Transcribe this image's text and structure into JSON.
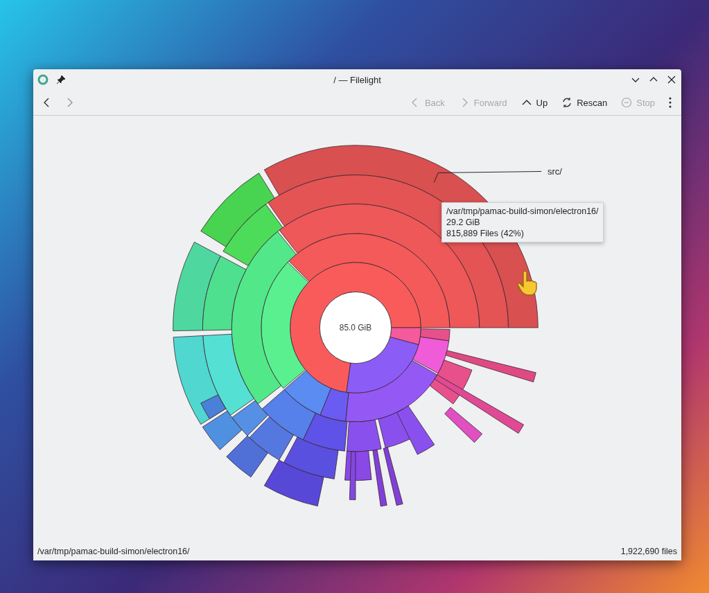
{
  "window": {
    "title": "/ — Filelight"
  },
  "nav": [
    {
      "kind": "back",
      "disabled": false
    },
    {
      "kind": "forward",
      "disabled": true
    }
  ],
  "toolbar": {
    "buttons": [
      {
        "kind": "back",
        "label": "Back",
        "disabled": true
      },
      {
        "kind": "forward",
        "label": "Forward",
        "disabled": true
      },
      {
        "kind": "up",
        "label": "Up",
        "disabled": false
      },
      {
        "kind": "rescan",
        "label": "Rescan",
        "disabled": false
      },
      {
        "kind": "stop",
        "label": "Stop",
        "disabled": true
      }
    ]
  },
  "chart": {
    "center_label": "85.0 GiB",
    "hover_label": "src/",
    "tooltip": {
      "path": "/var/tmp/pamac-build-simon/electron16/",
      "size": "29.2 GiB",
      "files": "815,889 Files (42%)"
    }
  },
  "status_bar": {
    "path": "/var/tmp/pamac-build-simon/electron16/",
    "file_count": "1,922,690 files"
  }
}
